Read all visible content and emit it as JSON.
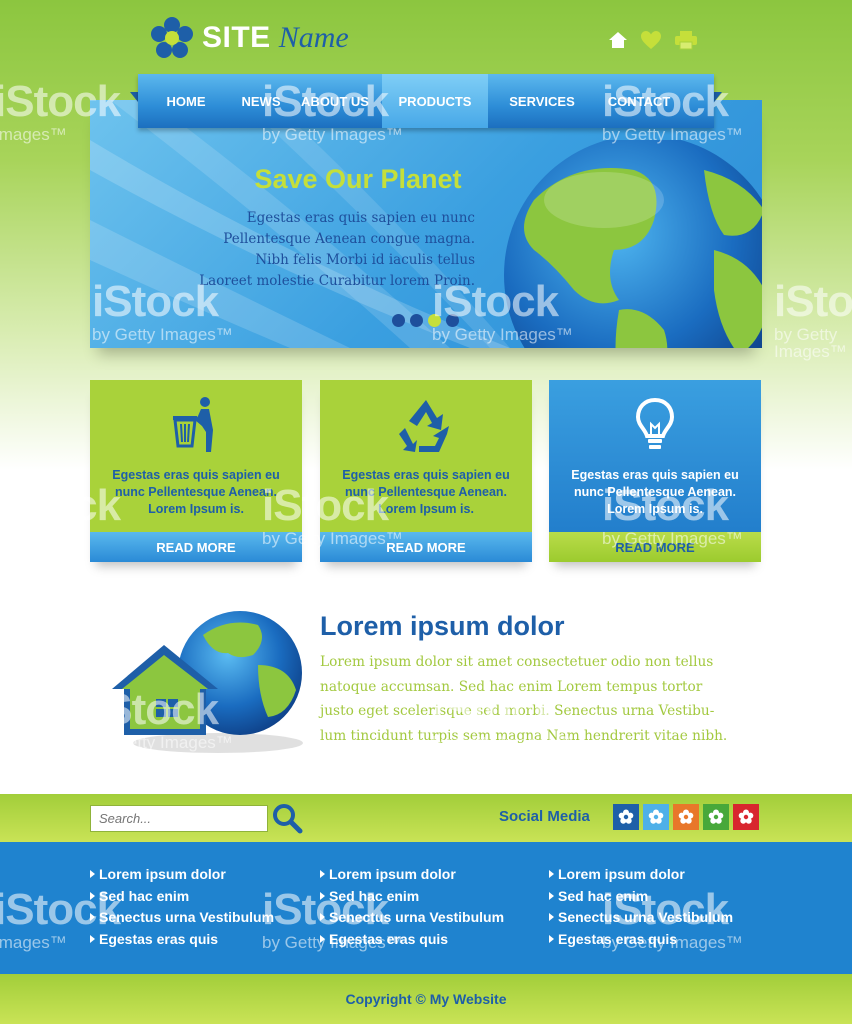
{
  "header": {
    "logo_site": "SITE",
    "logo_name": "Name",
    "icons": [
      "home-icon",
      "heart-icon",
      "printer-icon"
    ]
  },
  "nav": {
    "items": [
      {
        "label": "HOME"
      },
      {
        "label": "NEWS"
      },
      {
        "label": "ABOUT US"
      },
      {
        "label": "PRODUCTS",
        "active": true
      },
      {
        "label": "SERVICES"
      },
      {
        "label": "CONTACT"
      }
    ]
  },
  "slider": {
    "title": "Save Our Planet",
    "lines": [
      "Egestas eras quis sapien eu nunc",
      "Pellentesque Aenean congue magna.",
      "Nibh felis Morbi id iaculis tellus",
      "Laoreet molestie Curabitur lorem Proin."
    ],
    "dots": 4,
    "active_dot": 3
  },
  "cards": [
    {
      "icon": "trash-bin-icon",
      "text": "Egestas eras quis sapien eu nunc Pellentesque Aenean. Lorem Ipsum is.",
      "button": "READ MORE",
      "style": "green"
    },
    {
      "icon": "recycle-icon",
      "text": "Egestas eras quis sapien eu nunc Pellentesque Aenean. Lorem Ipsum is.",
      "button": "READ MORE",
      "style": "green"
    },
    {
      "icon": "light-bulb-icon",
      "text": "Egestas eras quis sapien eu nunc Pellentesque Aenean. Lorem Ipsum is.",
      "button": "READ MORE",
      "style": "blue"
    }
  ],
  "content": {
    "title": "Lorem ipsum dolor",
    "lines": [
      "Lorem ipsum dolor sit amet consectetuer odio non tellus",
      "natoque accumsan. Sed hac enim Lorem tempus tortor",
      "justo eget scelerisque sed morbi. Senectus urna Vestibu-",
      "lum tincidunt turpis sem magna Nam hendrerit vitae nibh."
    ]
  },
  "search": {
    "placeholder": "Search..."
  },
  "social": {
    "label": "Social Media",
    "colors": [
      "#1e5fa8",
      "#4fb0e8",
      "#e8772a",
      "#48a83a",
      "#d8262e"
    ]
  },
  "links": {
    "columns": [
      [
        "Lorem ipsum dolor",
        "Sed hac enim",
        "Senectus urna Vestibulum",
        "Egestas eras quis"
      ],
      [
        "Lorem ipsum dolor",
        "Sed hac enim",
        "Senectus urna Vestibulum",
        "Egestas eras quis"
      ],
      [
        "Lorem ipsum dolor",
        "Sed hac enim",
        "Senectus urna Vestibulum",
        "Egestas eras quis"
      ]
    ]
  },
  "footer": {
    "copyright": "Copyright © My Website"
  },
  "watermark": {
    "brand": "iStock",
    "sub": "by Getty Images™",
    "images_text": "Images™"
  },
  "colors": {
    "brand_green": "#a9d23a",
    "brand_blue": "#1e5fa8",
    "sky_blue": "#3a9fe0",
    "accent_lime": "#c5df3a"
  }
}
